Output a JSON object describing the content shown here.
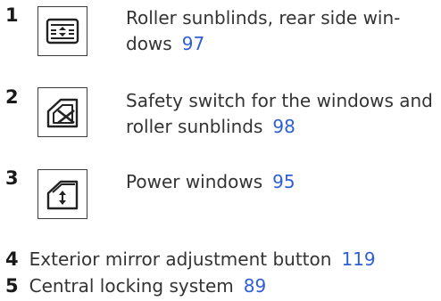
{
  "items": [
    {
      "number": "1",
      "text_line1": "Roller sunblinds, rear side win-",
      "text_line2": "dows",
      "page": "97",
      "icon": "roller-sunblind-icon"
    },
    {
      "number": "2",
      "text_line1": "Safety switch for the windows and",
      "text_line2": "roller sunblinds",
      "page": "98",
      "icon": "window-safety-switch-icon"
    },
    {
      "number": "3",
      "text_line1": "Power windows",
      "page": "95",
      "icon": "power-window-icon"
    },
    {
      "number": "4",
      "text_line1": "Exterior mirror adjustment button",
      "page": "119"
    },
    {
      "number": "5",
      "text_line1": "Central locking system",
      "page": "89"
    }
  ],
  "colors": {
    "text": "#333333",
    "link": "#2f5fd6"
  }
}
